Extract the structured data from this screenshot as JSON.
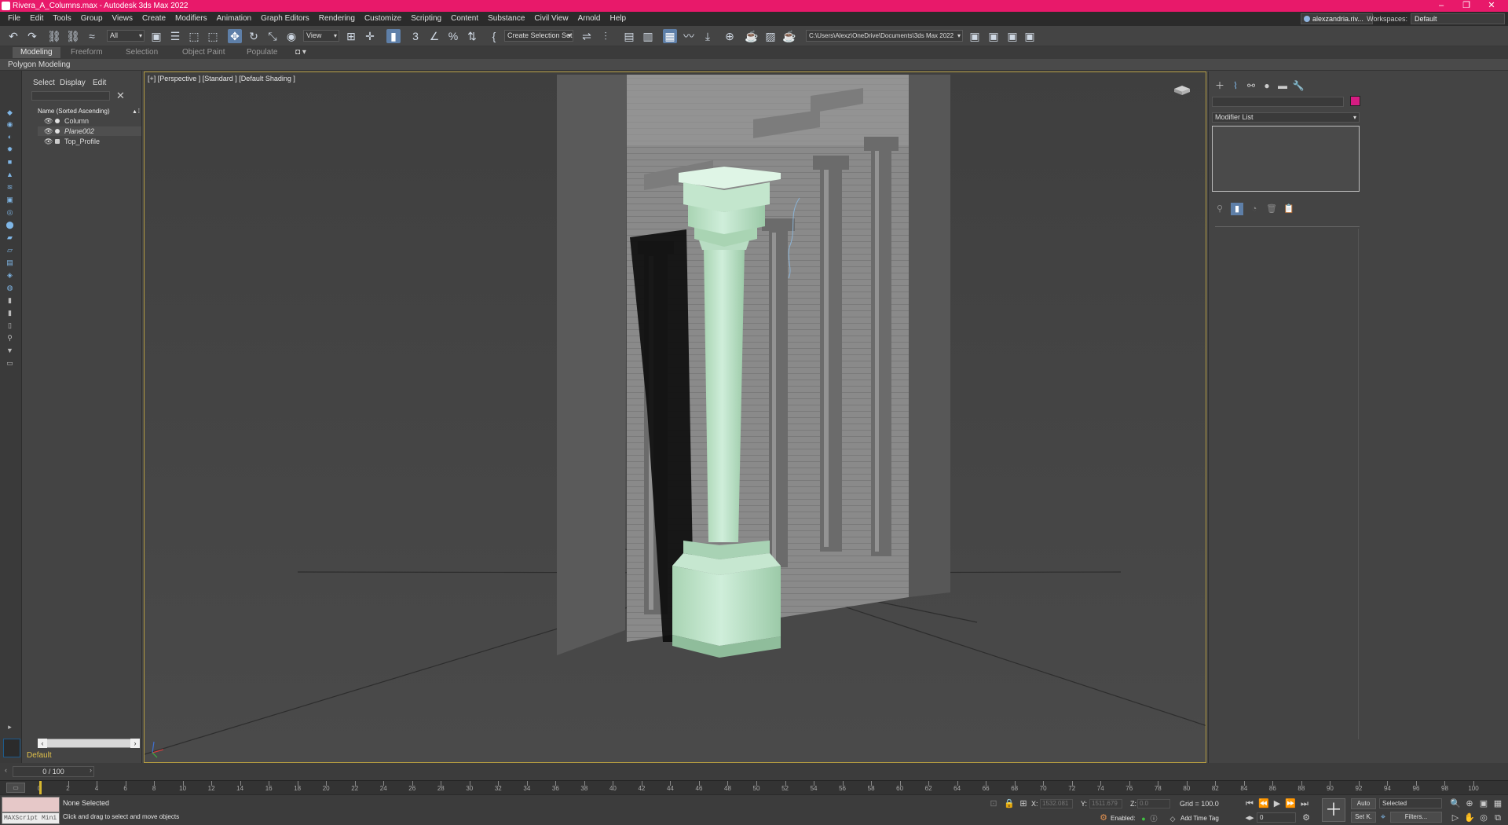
{
  "window": {
    "title": "Rivera_A_Columns.max - Autodesk 3ds Max 2022",
    "user": "alexzandria.riv...",
    "workspaces_label": "Workspaces:",
    "workspace_value": "Default"
  },
  "menu": [
    "File",
    "Edit",
    "Tools",
    "Group",
    "Views",
    "Create",
    "Modifiers",
    "Animation",
    "Graph Editors",
    "Rendering",
    "Customize",
    "Scripting",
    "Content",
    "Substance",
    "Civil View",
    "Arnold",
    "Help"
  ],
  "toolbar": {
    "filter": "All",
    "ref_coord": "View",
    "selection_set": "Create Selection Set",
    "project_path": "C:\\Users\\Alexz\\OneDrive\\Documents\\3ds Max 2022"
  },
  "ribbon": {
    "tabs": [
      "Modeling",
      "Freeform",
      "Selection",
      "Object Paint",
      "Populate"
    ],
    "panel_label": "Polygon Modeling"
  },
  "explorer": {
    "tabs": [
      "Select",
      "Display",
      "Edit"
    ],
    "header": "Name (Sorted Ascending)",
    "items": [
      "Column",
      "Plane002",
      "Top_Profile"
    ],
    "layer": "Default"
  },
  "viewport": {
    "label": "[+] [Perspective ] [Standard ] [Default Shading ]"
  },
  "command_panel": {
    "modifier_list": "Modifier List"
  },
  "timeline": {
    "slider": "0 / 100",
    "ticks": [
      "0",
      "2",
      "4",
      "6",
      "8",
      "10",
      "12",
      "14",
      "16",
      "18",
      "20",
      "22",
      "24",
      "26",
      "28",
      "30",
      "32",
      "34",
      "36",
      "38",
      "40",
      "42",
      "44",
      "46",
      "48",
      "50",
      "52",
      "54",
      "56",
      "58",
      "60",
      "62",
      "64",
      "66",
      "68",
      "70",
      "72",
      "74",
      "76",
      "78",
      "80",
      "82",
      "84",
      "86",
      "88",
      "90",
      "92",
      "94",
      "96",
      "98",
      "100"
    ]
  },
  "status": {
    "maxscript": "MAXScript Mini",
    "selection": "None Selected",
    "prompt": "Click and drag to select and move objects",
    "x_label": "X:",
    "x_value": "1532.081",
    "y_label": "Y:",
    "y_value": "1511.679",
    "z_label": "Z:",
    "z_value": "0.0",
    "grid": "Grid = 100.0",
    "enabled": "Enabled:",
    "add_time_tag": "Add Time Tag",
    "auto": "Auto",
    "selected": "Selected",
    "set_k": "Set K.",
    "filters": "Filters...",
    "frame": "0"
  }
}
